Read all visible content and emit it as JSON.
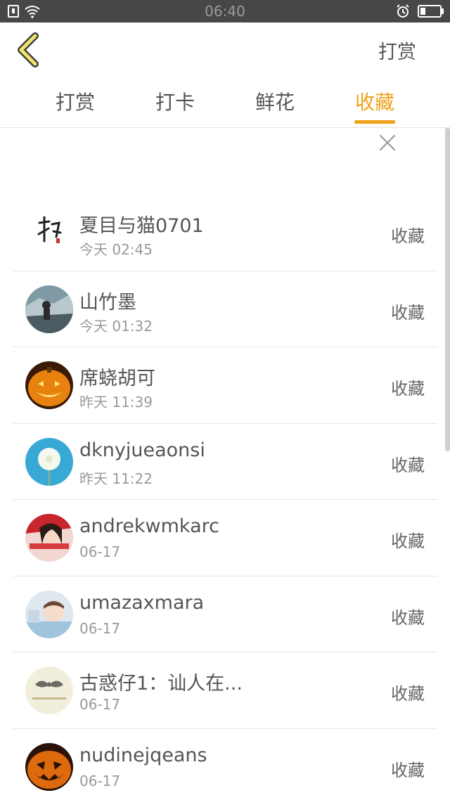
{
  "status_bar": {
    "time": "06:40"
  },
  "header": {
    "action_label": "打赏"
  },
  "tabs": [
    {
      "label": "打赏"
    },
    {
      "label": "打卡"
    },
    {
      "label": "鲜花"
    },
    {
      "label": "收藏"
    }
  ],
  "active_tab": "收藏",
  "colors": {
    "accent": "#f0a21b",
    "status_bar": "#474747"
  },
  "list": [
    {
      "name": "夏目与猫0701",
      "time": "今天 02:45",
      "action": "收藏",
      "avatar": "calligraphy-avatar"
    },
    {
      "name": "山竹墨",
      "time": "今天 01:32",
      "action": "收藏",
      "avatar": "photo-avatar"
    },
    {
      "name": "席蛲胡可",
      "time": "昨天 11:39",
      "action": "收藏",
      "avatar": "pumpkin-avatar"
    },
    {
      "name": "dknyjueaonsi",
      "time": "昨天 11:22",
      "action": "收藏",
      "avatar": "dandelion-avatar"
    },
    {
      "name": "andrekwmkarc",
      "time": "06-17",
      "action": "收藏",
      "avatar": "photo-avatar"
    },
    {
      "name": "umazaxmara",
      "time": "06-17",
      "action": "收藏",
      "avatar": "photo-avatar"
    },
    {
      "name": "古惑仔1：讪人在...",
      "time": "06-17",
      "action": "收藏",
      "avatar": "mustache-avatar"
    },
    {
      "name": "nudinejqeans",
      "time": "06-17",
      "action": "收藏",
      "avatar": "pumpkin-avatar"
    }
  ]
}
